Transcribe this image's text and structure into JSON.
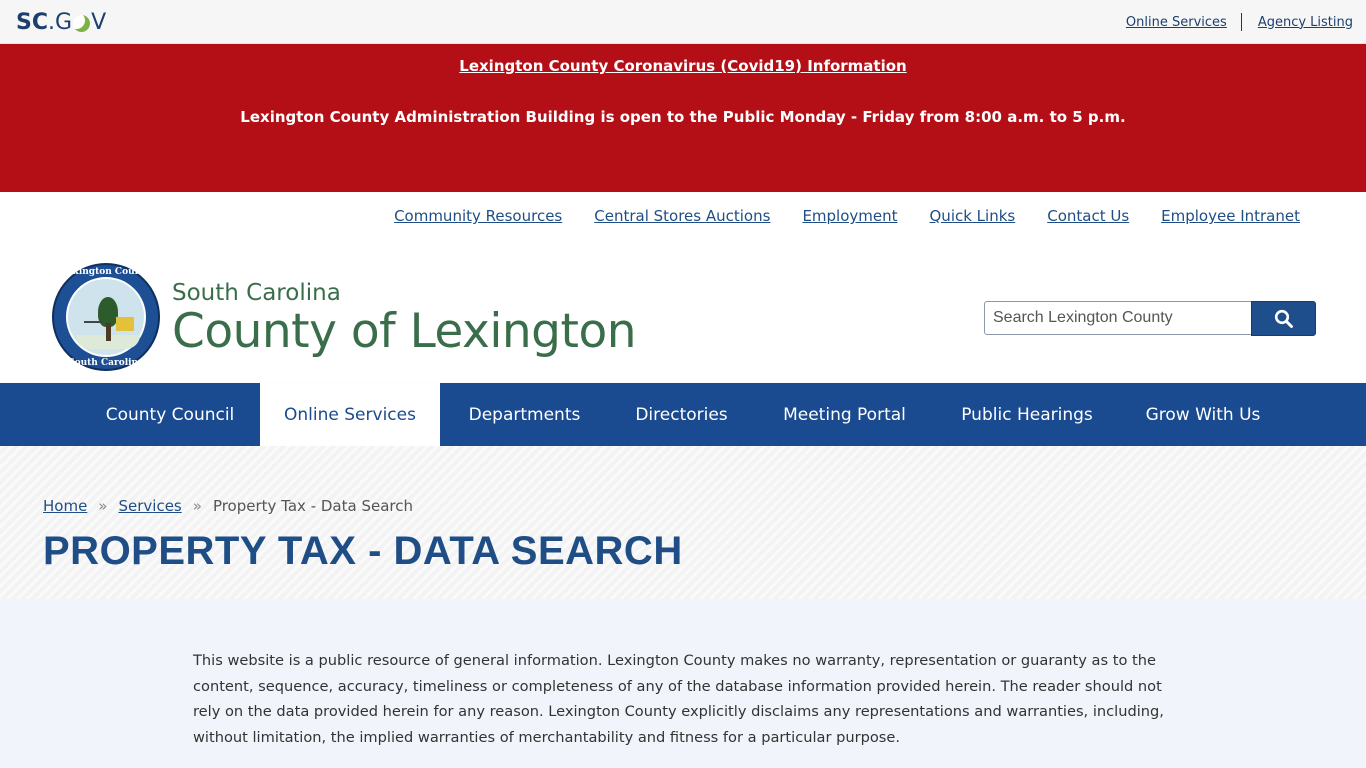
{
  "scgov": {
    "logo_sc": "SC",
    "logo_dot": ".",
    "logo_g": "G",
    "logo_v": "V",
    "links": [
      "Online Services",
      "Agency Listing"
    ]
  },
  "alert": {
    "link": "Lexington County Coronavirus (Covid19) Information",
    "text": "Lexington County Administration Building is open to the Public Monday - Friday from 8:00 a.m. to 5 p.m."
  },
  "utility_nav": [
    "Community Resources",
    "Central Stores Auctions",
    "Employment",
    "Quick Links",
    "Contact Us",
    "Employee Intranet"
  ],
  "header": {
    "state": "South Carolina",
    "county": "County of Lexington",
    "seal_top": "Lexington County",
    "seal_bottom": "South Carolina"
  },
  "search": {
    "placeholder": "Search Lexington County"
  },
  "main_nav": {
    "items": [
      "County Council",
      "Online Services",
      "Departments",
      "Directories",
      "Meeting Portal",
      "Public Hearings",
      "Grow With Us"
    ],
    "active": "Online Services"
  },
  "breadcrumb": {
    "home": "Home",
    "sep": "»",
    "services": "Services",
    "current": "Property Tax - Data Search"
  },
  "page": {
    "title": "PROPERTY TAX - DATA SEARCH",
    "disclaimer": "This website is a public resource of general information. Lexington County makes no warranty, representation or guaranty as to the content, sequence, accuracy, timeliness or completeness of any of the database information provided herein. The reader should not rely on the data provided herein for any reason. Lexington County explicitly disclaims any representations and warranties, including, without limitation, the implied warranties of merchantability and fitness for a particular purpose."
  },
  "colors": {
    "alert_red": "#b40f17",
    "nav_blue": "#1a4a8f",
    "county_green": "#3a6e4a"
  }
}
